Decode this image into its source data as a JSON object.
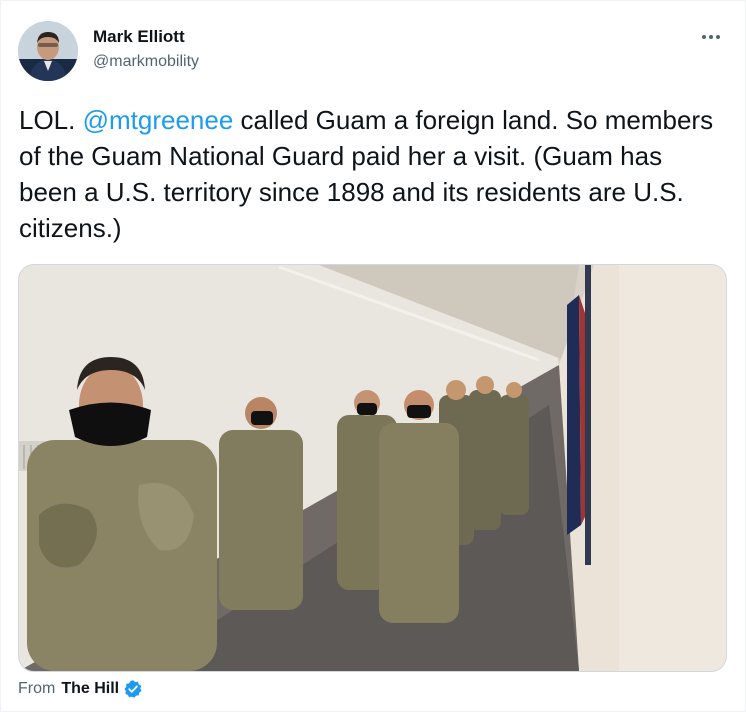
{
  "user": {
    "name": "Mark Elliott",
    "handle": "@markmobility"
  },
  "tweet": {
    "text_before": "LOL. ",
    "mention": "@mtgreenee",
    "text_after": " called Guam a foreign land. So members of the Guam National Guard paid her a visit. (Guam has been a U.S. territory since 1898 and its residents are U.S. citizens.)"
  },
  "source": {
    "prefix": "From",
    "name": "The Hill"
  },
  "icons": {
    "more": "more-options-icon",
    "verified": "verified-badge-icon"
  },
  "colors": {
    "link": "#1d9bf0",
    "text": "#0f1419",
    "secondary": "#536471"
  }
}
